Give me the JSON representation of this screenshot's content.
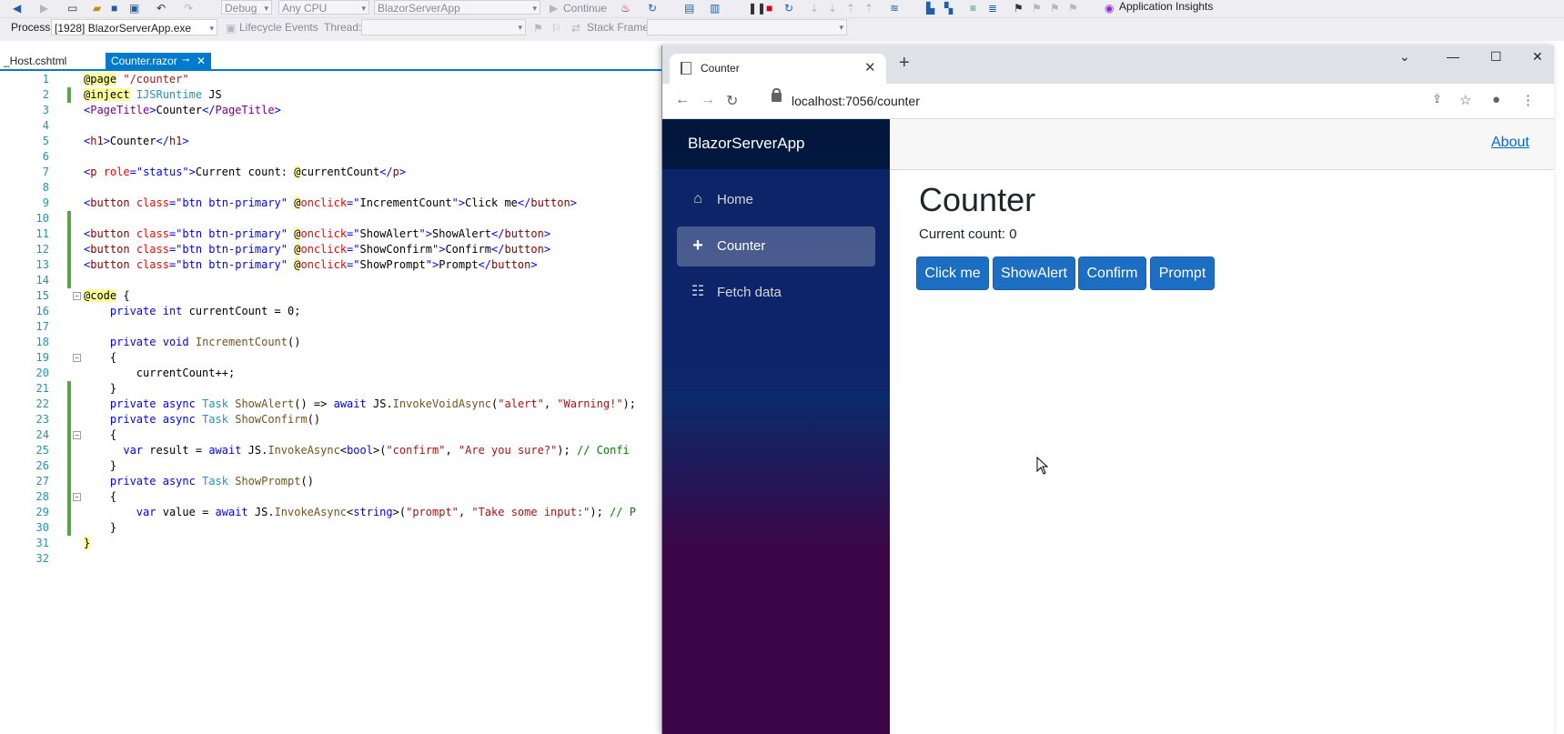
{
  "toolbar": {
    "configuration": "Debug",
    "platform": "Any CPU",
    "startup_project": "BlazorServerApp",
    "continue_label": "Continue",
    "app_insights": "Application Insights"
  },
  "debug_location": {
    "process_label": "Process:",
    "process_value": "[1928] BlazorServerApp.exe",
    "lifecycle_label": "Lifecycle Events",
    "thread_label": "Thread:",
    "stack_frame_label": "Stack Frame:"
  },
  "tabs": [
    {
      "label": "_Host.cshtml"
    },
    {
      "label": "Counter.razor",
      "pin": "⊸",
      "close": "✕"
    }
  ],
  "code_lines": [
    "1",
    "2",
    "3",
    "4",
    "5",
    "6",
    "7",
    "8",
    "9",
    "10",
    "11",
    "12",
    "13",
    "14",
    "15",
    "16",
    "17",
    "18",
    "19",
    "20",
    "21",
    "22",
    "23",
    "24",
    "25",
    "26",
    "27",
    "28",
    "29",
    "30",
    "31",
    "32"
  ],
  "browser": {
    "tab_title": "Counter",
    "url": "localhost:7056/counter",
    "brand": "BlazorServerApp",
    "nav": [
      {
        "label": "Home",
        "icon": "home-icon"
      },
      {
        "label": "Counter",
        "icon": "plus-icon"
      },
      {
        "label": "Fetch data",
        "icon": "list-icon"
      }
    ],
    "about_link": "About",
    "heading": "Counter",
    "current_count": "Current count: 0",
    "buttons": [
      "Click me",
      "ShowAlert",
      "Confirm",
      "Prompt"
    ]
  }
}
